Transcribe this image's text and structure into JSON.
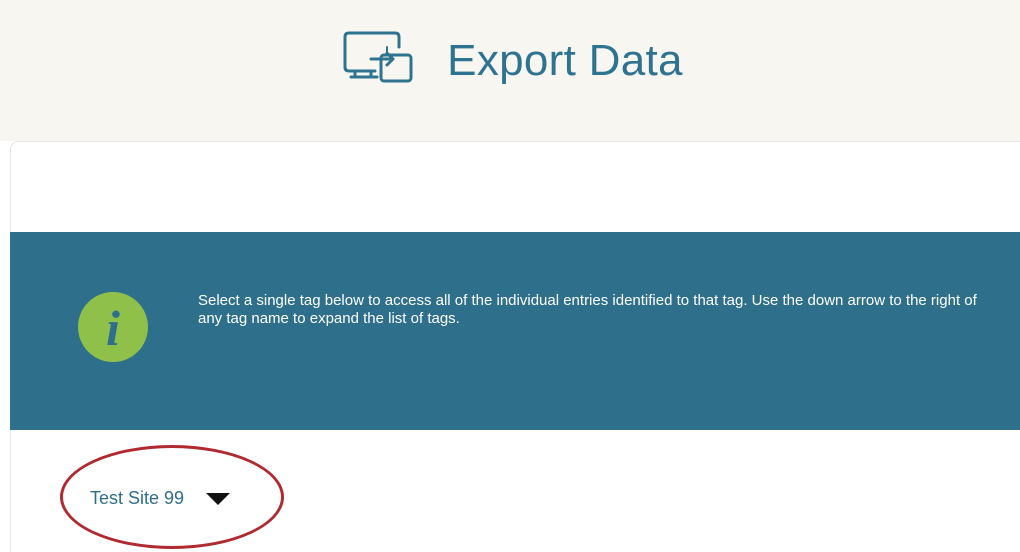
{
  "header": {
    "title": "Export Data",
    "icon": "export-monitor-icon"
  },
  "info": {
    "icon": "info-icon",
    "glyph": "i",
    "message": "Select a single tag below to access all of the individual entries identified to that tag. Use the down arrow to the right of any tag name to expand the list of tags."
  },
  "tag_selector": {
    "selected": "Test Site 99",
    "arrow_icon": "caret-down-icon"
  },
  "annotation": {
    "type": "red-ellipse-highlight"
  },
  "colors": {
    "header_bg": "#f8f6f1",
    "brand_teal": "#2e7490",
    "banner_bg": "#2e6f8c",
    "info_badge": "#8fc14a",
    "annotation": "#b02a2f"
  }
}
